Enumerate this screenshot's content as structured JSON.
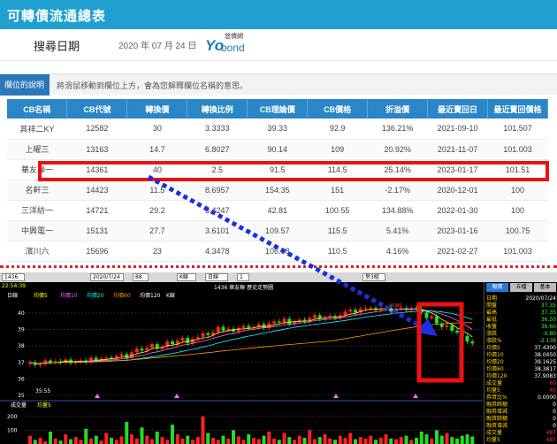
{
  "page": {
    "title": "可轉債流通總表",
    "search_label": "搜尋日期",
    "date": "2020 年 07 月 24 日",
    "logo_small": "悠債網",
    "logo_yo": "Yo",
    "logo_bond": "bond",
    "desc_tag": "欄位的說明",
    "desc_text": "將滑鼠移動到欄位上方，會為您解釋欄位名稱的意思。"
  },
  "table": {
    "headers": [
      "CB名稱",
      "CB代號",
      "轉換價",
      "轉換比例",
      "CB理論價",
      "CB價格",
      "折溢價",
      "最近賣回日",
      "最近賣回價格"
    ],
    "rows": [
      [
        "其祥二KY",
        "12582",
        "30",
        "3.3333",
        "39.33",
        "92.9",
        "136.21%",
        "2021-09-10",
        "101.507"
      ],
      [
        "上曜三",
        "13163",
        "14.7",
        "6.8027",
        "90.14",
        "109",
        "20.92%",
        "2021-11-07",
        "101.003"
      ],
      [
        "華友聯一",
        "14361",
        "40",
        "2.5",
        "91.5",
        "114.5",
        "25.14%",
        "2023-01-17",
        "101.51"
      ],
      [
        "名軒三",
        "14423",
        "11.5",
        "8.6957",
        "154.35",
        "151",
        "-2.17%",
        "2020-12-01",
        "100"
      ],
      [
        "三洋紡一",
        "14721",
        "29.2",
        "3.4247",
        "42.81",
        "100.55",
        "134.88%",
        "2022-01-30",
        "100"
      ],
      [
        "中興電一",
        "15131",
        "27.7",
        "3.6101",
        "109.57",
        "115.5",
        "5.41%",
        "2023-01-16",
        "100.75"
      ],
      [
        "濱川六",
        "15696",
        "23",
        "4.3478",
        "106.98",
        "110.5",
        "4.16%",
        "2021-02-27",
        "101.003"
      ]
    ]
  },
  "terminal": {
    "toolbar": {
      "symbol": "1436",
      "date": "2020/7/24",
      "count": "88",
      "k_label": "K線",
      "period": "日線",
      "vol": "1",
      "small": "參3組"
    },
    "time": "22:54:39",
    "chart_title": "1436 華友聯  歷史走勢圖",
    "ma_legend": [
      "日線",
      "均價5",
      "均價10",
      "均價20",
      "均價60",
      "均價120",
      "K線"
    ],
    "vol_legend": [
      "成交量",
      "均量5"
    ],
    "y_ticks": [
      "40",
      "39",
      "38",
      "37",
      "36",
      "35"
    ],
    "vol_ticks": [
      "200",
      "100"
    ],
    "low_label": "35.55",
    "high_label": "40.60",
    "panel_tabs": [
      "報價",
      "五檔",
      "基本"
    ],
    "panel": [
      {
        "k": "日期",
        "v": "2020/07/24",
        "c": "#ffffff"
      },
      {
        "k": "開盤",
        "v": "37.35",
        "c": "#33ff33"
      },
      {
        "k": "最高",
        "v": "37.35",
        "c": "#33ff33"
      },
      {
        "k": "最低",
        "v": "36.50",
        "c": "#33ff33"
      },
      {
        "k": "收盤",
        "v": "36.60",
        "c": "#33ff33"
      },
      {
        "k": "漲跌",
        "v": "-0.80",
        "c": "#33ff33"
      },
      {
        "k": "漲跌%",
        "v": "-2.139",
        "c": "#33ff33"
      },
      {
        "k": "均價5",
        "v": "37.4300",
        "c": "#ffffff"
      },
      {
        "k": "均價10",
        "v": "38.0450",
        "c": "#ffffff"
      },
      {
        "k": "均價20",
        "v": "39.1625",
        "c": "#ffffff"
      },
      {
        "k": "均價60",
        "v": "38.3817",
        "c": "#ffffff"
      },
      {
        "k": "均價120",
        "v": "37.9083",
        "c": "#ffffff"
      },
      {
        "k": "成交量",
        "v": "60",
        "c": "#ff3333"
      },
      {
        "k": "均量5",
        "v": "40",
        "c": "#ff3333"
      },
      {
        "k": "券資比%",
        "v": "0.0000",
        "c": "#ffffff"
      },
      {
        "k": "融券餘額",
        "v": "0",
        "c": "#ffffff"
      },
      {
        "k": "融券增減",
        "v": "0",
        "c": "#ffffff"
      },
      {
        "k": "融資餘額",
        "v": "0",
        "c": "#ffffff"
      },
      {
        "k": "融資增減",
        "v": "0",
        "c": "#ffffff"
      },
      {
        "k": "成交量",
        "v": "487",
        "c": "#ff3333"
      },
      {
        "k": "均量5",
        "v": "487",
        "c": "#ff3333"
      }
    ]
  },
  "colors": {
    "header_blue": "#1fa0d0",
    "table_head": "#2a86c6",
    "up": "#ff2222",
    "down": "#22dd22",
    "highlight": "#ee1111",
    "arrow": "#1a2fe0"
  }
}
